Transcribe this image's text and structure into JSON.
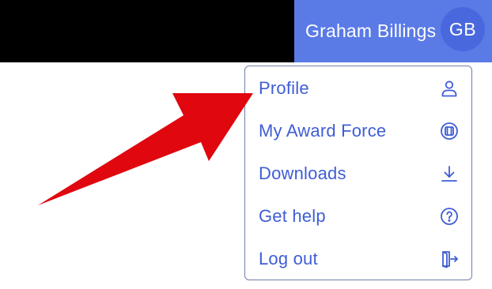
{
  "header": {
    "user_name": "Graham Billings",
    "avatar_initials": "GB"
  },
  "menu": {
    "items": [
      {
        "label": "Profile",
        "icon": "user-icon"
      },
      {
        "label": "My Award Force",
        "icon": "award-force-icon"
      },
      {
        "label": "Downloads",
        "icon": "download-icon"
      },
      {
        "label": "Get help",
        "icon": "help-icon"
      },
      {
        "label": "Log out",
        "icon": "logout-icon"
      }
    ]
  },
  "annotation": {
    "arrow_color": "#e0070f",
    "points_to": "Profile"
  },
  "colors": {
    "topbar": "#000000",
    "user_block": "#5a7ae6",
    "avatar": "#4968de",
    "menu_text": "#3f5dd6",
    "menu_border": "#6f7fa8"
  }
}
